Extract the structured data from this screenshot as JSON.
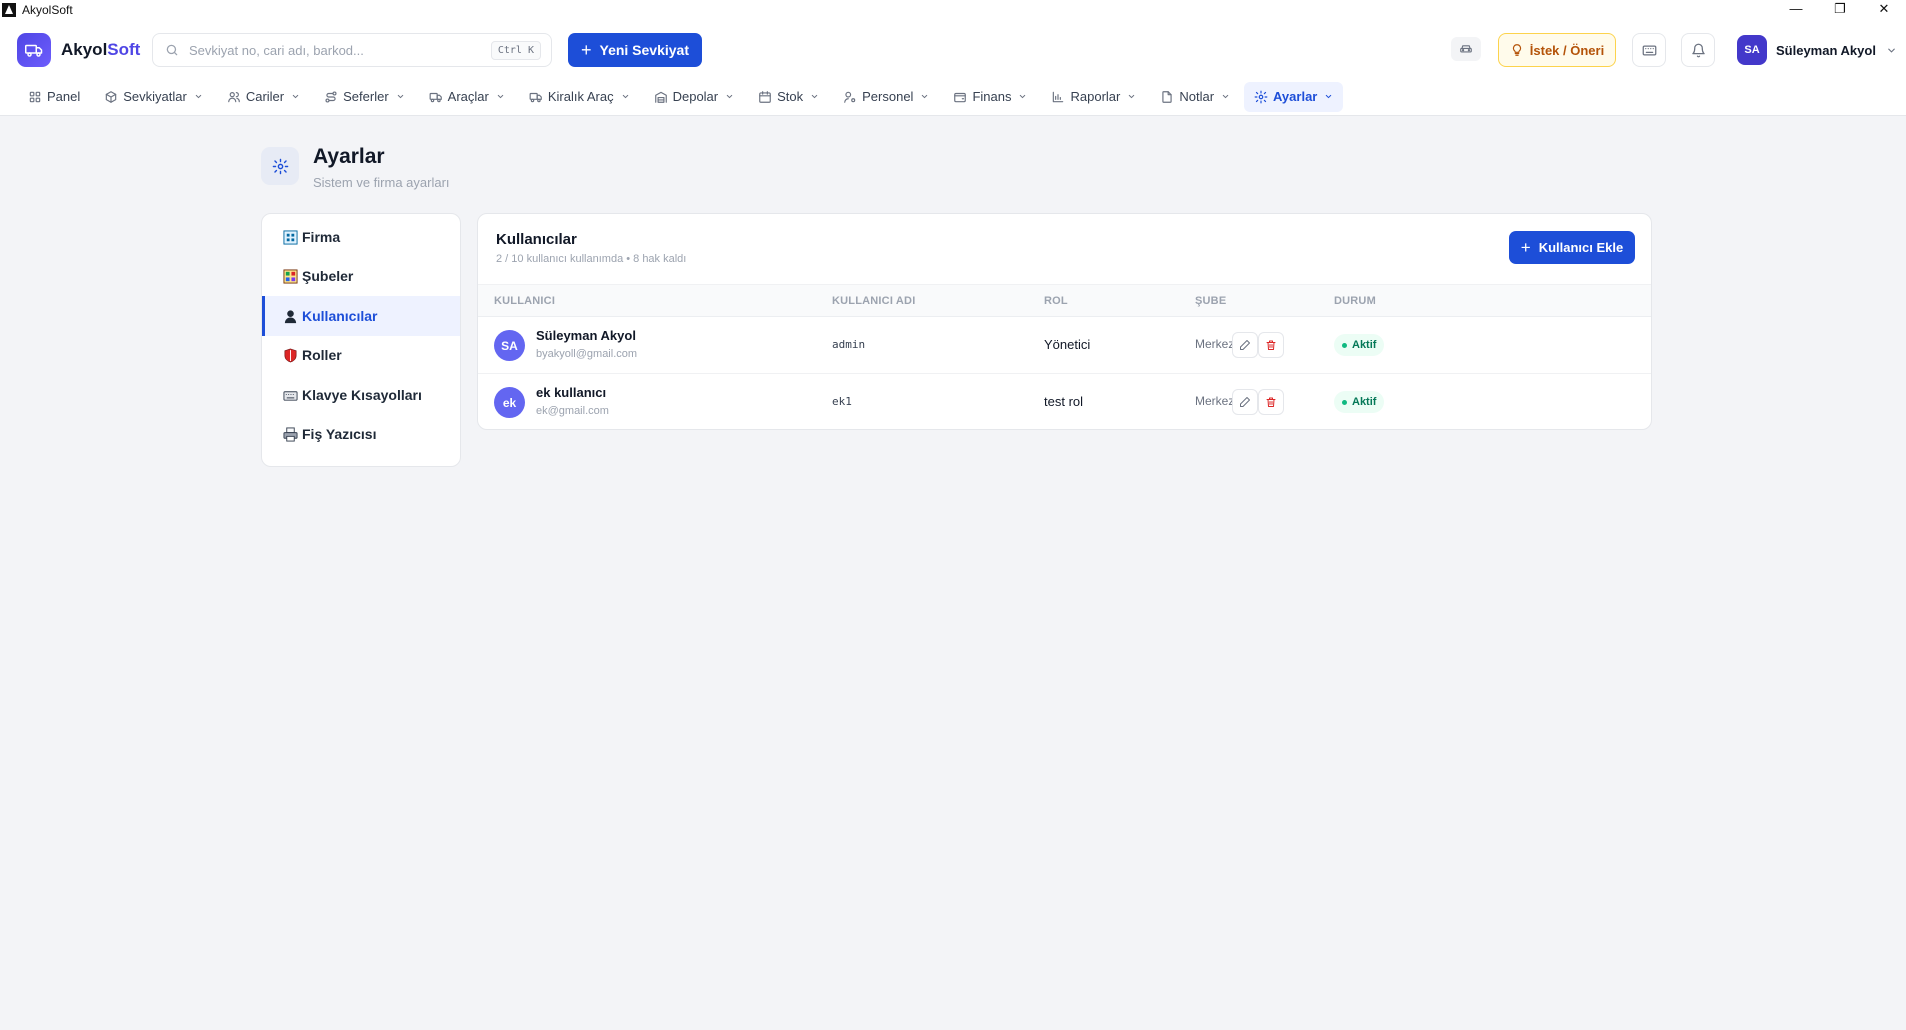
{
  "window": {
    "title": "AkyolSoft",
    "minimize": "—",
    "restore": "❐",
    "close": "✕"
  },
  "header": {
    "logo_main": "Akyol",
    "logo_accent": "Soft",
    "search_placeholder": "Sevkiyat no, cari adı, barkod...",
    "search_shortcut": "Ctrl K",
    "new_shipment_label": "Yeni Sevkiyat",
    "suggest_label": "İstek / Öneri",
    "user": {
      "initials": "SA",
      "name": "Süleyman Akyol"
    }
  },
  "nav": [
    {
      "label": "Panel",
      "icon": "grid-icon",
      "dropdown": false
    },
    {
      "label": "Sevkiyatlar",
      "icon": "box-icon",
      "dropdown": true
    },
    {
      "label": "Cariler",
      "icon": "users-icon",
      "dropdown": true
    },
    {
      "label": "Seferler",
      "icon": "route-icon",
      "dropdown": true
    },
    {
      "label": "Araçlar",
      "icon": "truck-icon",
      "dropdown": true
    },
    {
      "label": "Kiralık Araç",
      "icon": "truck-icon",
      "dropdown": true
    },
    {
      "label": "Depolar",
      "icon": "warehouse-icon",
      "dropdown": true
    },
    {
      "label": "Stok",
      "icon": "calendar-icon",
      "dropdown": true
    },
    {
      "label": "Personel",
      "icon": "user-cog-icon",
      "dropdown": true
    },
    {
      "label": "Finans",
      "icon": "wallet-icon",
      "dropdown": true
    },
    {
      "label": "Raporlar",
      "icon": "bar-chart-icon",
      "dropdown": true
    },
    {
      "label": "Notlar",
      "icon": "file-icon",
      "dropdown": true
    },
    {
      "label": "Ayarlar",
      "icon": "gear-icon",
      "dropdown": true,
      "active": true
    }
  ],
  "page": {
    "title": "Ayarlar",
    "subtitle": "Sistem ve firma ayarları"
  },
  "settings_menu": [
    {
      "label": "Firma",
      "icon": "building-icon",
      "active": false
    },
    {
      "label": "Şubeler",
      "icon": "branches-icon",
      "active": false
    },
    {
      "label": "Kullanıcılar",
      "icon": "user-icon",
      "active": true
    },
    {
      "label": "Roller",
      "icon": "shield-icon",
      "active": false
    },
    {
      "label": "Klavye Kısayolları",
      "icon": "keyboard-icon",
      "active": false
    },
    {
      "label": "Fiş Yazıcısı",
      "icon": "printer-icon",
      "active": false
    }
  ],
  "users_panel": {
    "title": "Kullanıcılar",
    "subtitle": "2 / 10 kullanıcı kullanımda • 8 hak kaldı",
    "add_label": "Kullanıcı Ekle",
    "columns": [
      "KULLANICI",
      "KULLANICI ADI",
      "ROL",
      "ŞUBE",
      "DURUM"
    ],
    "rows": [
      {
        "initials": "SA",
        "name": "Süleyman Akyol",
        "email": "byakyoll@gmail.com",
        "username": "admin",
        "role": "Yönetici",
        "branch": "Merkez",
        "status": "Aktif"
      },
      {
        "initials": "ek",
        "name": "ek kullanıcı",
        "email": "ek@gmail.com",
        "username": "ek1",
        "role": "test rol",
        "branch": "Merkez",
        "status": "Aktif"
      }
    ]
  },
  "colors": {
    "primary": "#1d4ed8",
    "brand": "#4f46e5",
    "success": "#047857",
    "danger": "#dc2626",
    "warning": "#b45309"
  }
}
